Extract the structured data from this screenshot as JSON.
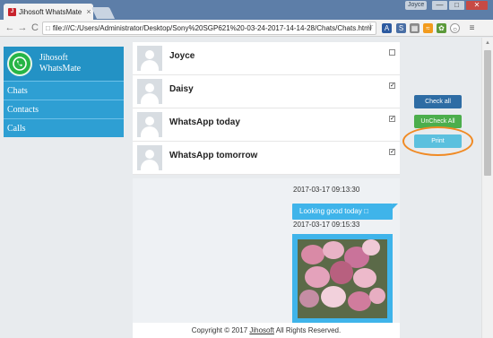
{
  "browser": {
    "tab_title": "Jihosoft WhatsMate",
    "favicon_text": "J",
    "tab_close": "×",
    "user_badge": "Joyce",
    "minimize": "—",
    "maximize": "□",
    "close": "✕",
    "back": "←",
    "forward": "→",
    "reload": "C",
    "url": "file:///C:/Users/Administrator/Desktop/Sony%20SGP621%20-03-24-2017-14-14-28/Chats/Chats.html"
  },
  "sidebar": {
    "brand_line1": "Jihosoft",
    "brand_line2": "WhatsMate",
    "items": [
      {
        "label": "Chats"
      },
      {
        "label": "Contacts"
      },
      {
        "label": "Calls"
      }
    ]
  },
  "chats": [
    {
      "name": "Joyce",
      "checked": false
    },
    {
      "name": "Daisy",
      "checked": true
    },
    {
      "name": "WhatsApp today",
      "checked": true
    },
    {
      "name": "WhatsApp tomorrow",
      "checked": true
    }
  ],
  "messages": {
    "timestamp_1": "2017-03-17 09:13:30",
    "text_1": "Looking good today",
    "text_1_emoji": "□",
    "timestamp_2": "2017-03-17 09:15:33"
  },
  "actions": {
    "check_all": "Check all",
    "uncheck_all": "UnCheck All",
    "print": "Print"
  },
  "footer": {
    "prefix": "Copyright © 2017",
    "link": "Jihosoft",
    "suffix": "All Rights Reserved."
  },
  "colors": {
    "accent": "#2392c5",
    "bubble": "#3fb4ea",
    "highlight": "#f08a24"
  }
}
